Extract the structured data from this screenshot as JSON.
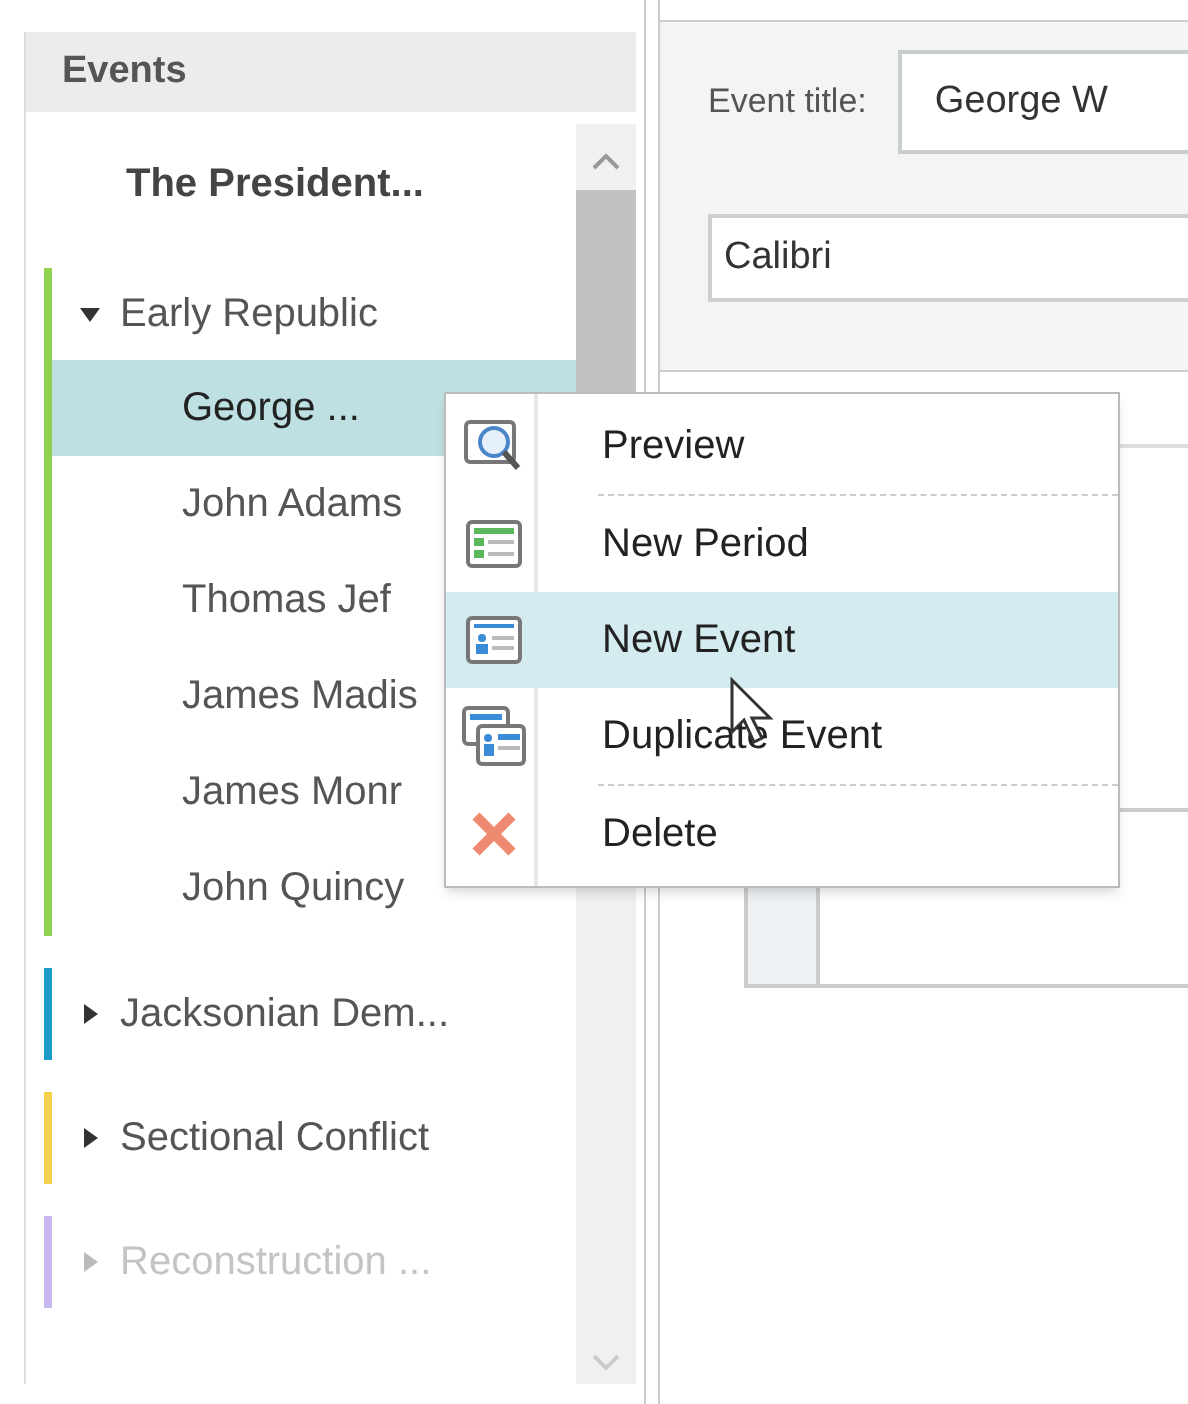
{
  "sidebar": {
    "title": "Events",
    "project": "The President...",
    "periods": [
      {
        "label": "Early Republic",
        "color": "#8fd14f",
        "expanded": true,
        "dimmed": false,
        "children": [
          {
            "label": "George ...",
            "selected": true
          },
          {
            "label": "John Adams",
            "selected": false
          },
          {
            "label": "Thomas Jef",
            "selected": false
          },
          {
            "label": "James Madis",
            "selected": false
          },
          {
            "label": "James Monr",
            "selected": false
          },
          {
            "label": "John Quincy",
            "selected": false
          }
        ]
      },
      {
        "label": "Jacksonian Dem...",
        "color": "#1a9bc9",
        "expanded": false,
        "dimmed": false
      },
      {
        "label": "Sectional Conflict",
        "color": "#f5d04a",
        "expanded": false,
        "dimmed": false
      },
      {
        "label": "Reconstruction ...",
        "color": "#c9b8ef",
        "expanded": false,
        "dimmed": true
      }
    ]
  },
  "editor": {
    "title_label": "Event title:",
    "title_value": "George W",
    "font_value": "Calibri"
  },
  "context_menu": [
    {
      "kind": "preview",
      "label": "Preview",
      "selected": false,
      "separator_after": true
    },
    {
      "kind": "period",
      "label": "New Period",
      "selected": false,
      "separator_after": false
    },
    {
      "kind": "event",
      "label": "New Event",
      "selected": true,
      "separator_after": false
    },
    {
      "kind": "duplicate",
      "label": "Duplicate Event",
      "selected": false,
      "separator_after": true
    },
    {
      "kind": "delete",
      "label": "Delete",
      "selected": false,
      "separator_after": false
    }
  ]
}
